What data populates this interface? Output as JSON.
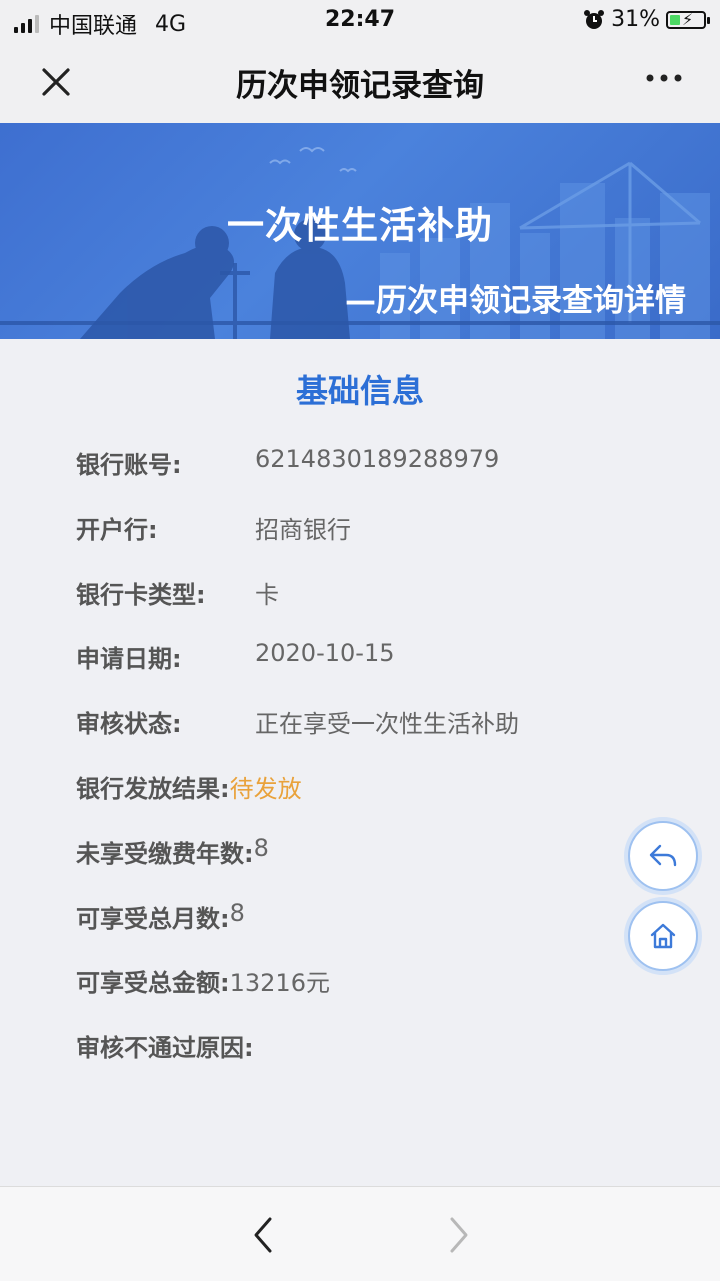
{
  "status_bar": {
    "carrier": "中国联通",
    "network": "4G",
    "time": "22:47",
    "battery": "31%",
    "battery_level": 0.31,
    "alarm_icon": "alarm-clock-icon"
  },
  "navbar": {
    "title": "历次申领记录查询",
    "close_icon": "close-icon",
    "more_icon": "more-dots-icon"
  },
  "banner": {
    "title": "一次性生活补助",
    "subtitle": "—历次申领记录查询详情"
  },
  "section": {
    "title": "基础信息"
  },
  "fields": [
    {
      "label": "银行账号:",
      "value": "6214830189288979"
    },
    {
      "label": "开户行:",
      "value": "招商银行"
    },
    {
      "label": "银行卡类型:",
      "value": "卡"
    },
    {
      "label": "申请日期:",
      "value": "2020-10-15"
    },
    {
      "label": "审核状态:",
      "value": "正在享受一次性生活补助"
    },
    {
      "label": "银行发放结果:",
      "value": "待发放"
    },
    {
      "label": "未享受缴费年数:",
      "value": "8"
    },
    {
      "label": "可享受总月数:",
      "value": "8"
    },
    {
      "label": "可享受总金额:",
      "value": "13216元"
    },
    {
      "label": "审核不通过原因:",
      "value": ""
    }
  ],
  "floating": {
    "back_icon": "reply-arrow-icon",
    "home_icon": "home-icon"
  },
  "bottom_bar": {
    "back_icon": "chevron-left-icon",
    "forward_icon": "chevron-right-icon"
  },
  "colors": {
    "accent": "#2c6fd6",
    "banner": "#4b82dc",
    "pending": "#e9a23b"
  }
}
